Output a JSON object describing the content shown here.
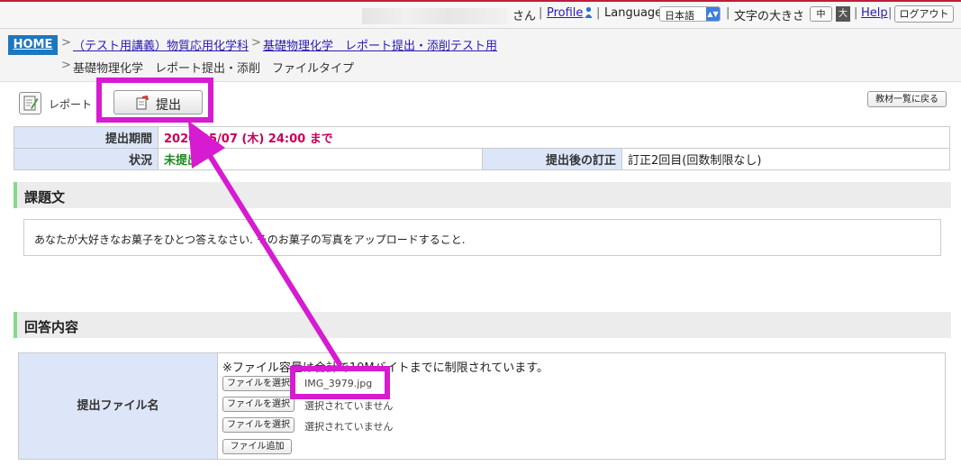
{
  "header": {
    "user_suffix": "さん",
    "profile_label": "Profile",
    "language_label": "Language",
    "language_value": "日本語",
    "font_size_label": "文字の大きさ",
    "font_mid": "中",
    "font_big": "大",
    "help_label": "Help",
    "logout_label": "ログアウト",
    "separator": "|"
  },
  "breadcrumb": {
    "home": "HOME",
    "course": "（テスト用講義）物質応用化学科",
    "assignment": "基礎物理化学　レポート提出・添削テスト用",
    "current": "基礎物理化学　レポート提出・添削　ファイルタイプ"
  },
  "toolbar": {
    "report_label": "レポート",
    "submit_label": "提出",
    "back_label": "教材一覧に戻る"
  },
  "info": {
    "period_label": "提出期間",
    "period_value": "2020/05/07 (木) 24:00 まで",
    "status_label": "状況",
    "status_value": "未提出",
    "correction_label": "提出後の訂正",
    "correction_value": "訂正2回目(回数制限なし)"
  },
  "assignment": {
    "title": "課題文",
    "text": "あなたが大好きなお菓子をひとつ答えなさい. そのお菓子の写真をアップロードすること."
  },
  "answer": {
    "title": "回答内容",
    "field_label": "提出ファイル名",
    "note": "※ファイル容量は合計で10Mバイトまでに制限されています。",
    "files": [
      {
        "button": "ファイルを選択",
        "value": "IMG_3979.jpg"
      },
      {
        "button": "ファイルを選択",
        "value": "選択されていません"
      },
      {
        "button": "ファイルを選択",
        "value": "選択されていません"
      }
    ],
    "add_label": "ファイル追加"
  },
  "colors": {
    "highlight": "#d61bd1",
    "home": "#1e77bd",
    "deadline": "#c8005a",
    "status": "#1f8a1f",
    "header_cell": "#dde6f8",
    "section_accent": "#86d98a"
  }
}
